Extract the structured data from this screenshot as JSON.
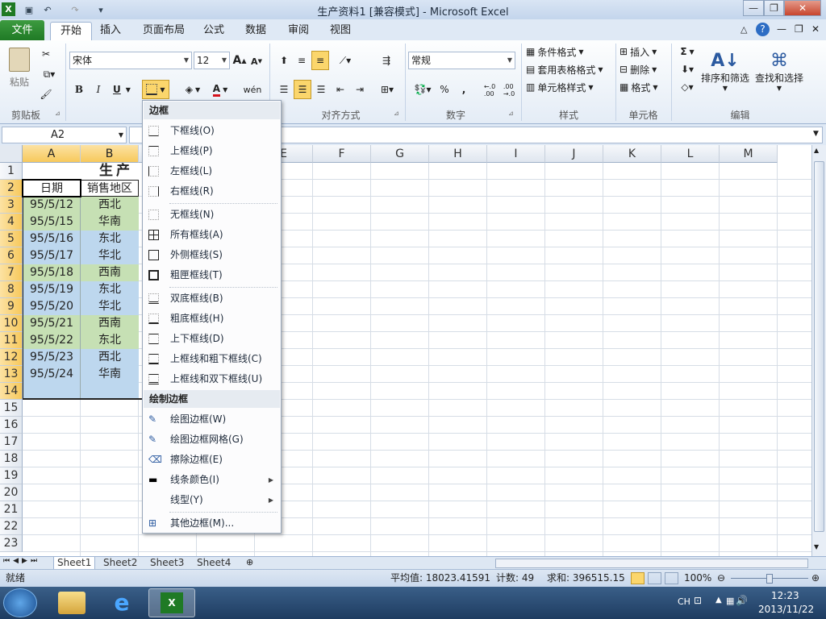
{
  "window": {
    "title": "生产资料1 [兼容模式] - Microsoft Excel",
    "app_icon": "excel-icon"
  },
  "tabs": {
    "file": "文件",
    "items": [
      "开始",
      "插入",
      "页面布局",
      "公式",
      "数据",
      "审阅",
      "视图"
    ],
    "active": 0
  },
  "ribbon": {
    "clipboard": {
      "label": "剪贴板",
      "paste": "粘贴"
    },
    "font": {
      "name": "宋体",
      "size": "12",
      "bold": "B",
      "italic": "I",
      "underline": "U",
      "grow": "A",
      "shrink": "A"
    },
    "alignment": {
      "label": "对齐方式"
    },
    "number": {
      "label": "数字",
      "format": "常规",
      "percent": "%",
      "comma": ",",
      "inc": "←.0 .00",
      "dec": ".00 →.0"
    },
    "styles": {
      "label": "样式",
      "cond": "条件格式",
      "table": "套用表格格式",
      "cell": "单元格样式"
    },
    "cells": {
      "label": "单元格",
      "insert": "插入",
      "delete": "删除",
      "format": "格式"
    },
    "editing": {
      "label": "编辑",
      "sort": "排序和筛选",
      "find": "查找和选择",
      "sigma": "Σ"
    }
  },
  "namebox": {
    "value": "A2"
  },
  "columns": [
    "A",
    "B",
    "C",
    "D",
    "E",
    "F",
    "G",
    "H",
    "I",
    "J",
    "K",
    "L",
    "M"
  ],
  "rows": [
    "1",
    "2",
    "3",
    "4",
    "5",
    "6",
    "7",
    "8",
    "9",
    "10",
    "11",
    "12",
    "13",
    "14",
    "15",
    "16",
    "17",
    "18",
    "19",
    "20",
    "21",
    "22",
    "23"
  ],
  "sheet": {
    "title": "生产",
    "headers": [
      "日期",
      "销售地区"
    ],
    "data": [
      {
        "date": "95/5/12",
        "region": "西北",
        "color": "#c6e0b4"
      },
      {
        "date": "95/5/15",
        "region": "华南",
        "color": "#c6e0b4"
      },
      {
        "date": "95/5/16",
        "region": "东北",
        "color": "#bdd7ee"
      },
      {
        "date": "95/5/17",
        "region": "华北",
        "color": "#bdd7ee"
      },
      {
        "date": "95/5/18",
        "region": "西南",
        "color": "#c6e0b4"
      },
      {
        "date": "95/5/19",
        "region": "东北",
        "color": "#bdd7ee"
      },
      {
        "date": "95/5/20",
        "region": "华北",
        "color": "#bdd7ee"
      },
      {
        "date": "95/5/21",
        "region": "西南",
        "color": "#c6e0b4"
      },
      {
        "date": "95/5/22",
        "region": "东北",
        "color": "#c6e0b4"
      },
      {
        "date": "95/5/23",
        "region": "西北",
        "color": "#bdd7ee"
      },
      {
        "date": "95/5/24",
        "region": "华南",
        "color": "#bdd7ee"
      },
      {
        "date": "",
        "region": "",
        "color": "#bdd7ee"
      }
    ]
  },
  "border_menu": {
    "header1": "边框",
    "items": [
      "下框线(O)",
      "上框线(P)",
      "左框线(L)",
      "右框线(R)",
      "无框线(N)",
      "所有框线(A)",
      "外侧框线(S)",
      "粗匣框线(T)",
      "双底框线(B)",
      "粗底框线(H)",
      "上下框线(D)",
      "上框线和粗下框线(C)",
      "上框线和双下框线(U)"
    ],
    "header2": "绘制边框",
    "draw_items": [
      "绘图边框(W)",
      "绘图边框网格(G)",
      "擦除边框(E)",
      "线条颜色(I)",
      "线型(Y)",
      "其他边框(M)..."
    ]
  },
  "sheets": [
    "Sheet1",
    "Sheet2",
    "Sheet3",
    "Sheet4"
  ],
  "status": {
    "ready": "就绪",
    "average": "平均值: 18023.41591",
    "count": "计数: 49",
    "sum": "求和: 396515.15",
    "zoom": "100%"
  },
  "taskbar": {
    "lang": "CH",
    "time": "12:23",
    "date": "2013/11/22"
  }
}
